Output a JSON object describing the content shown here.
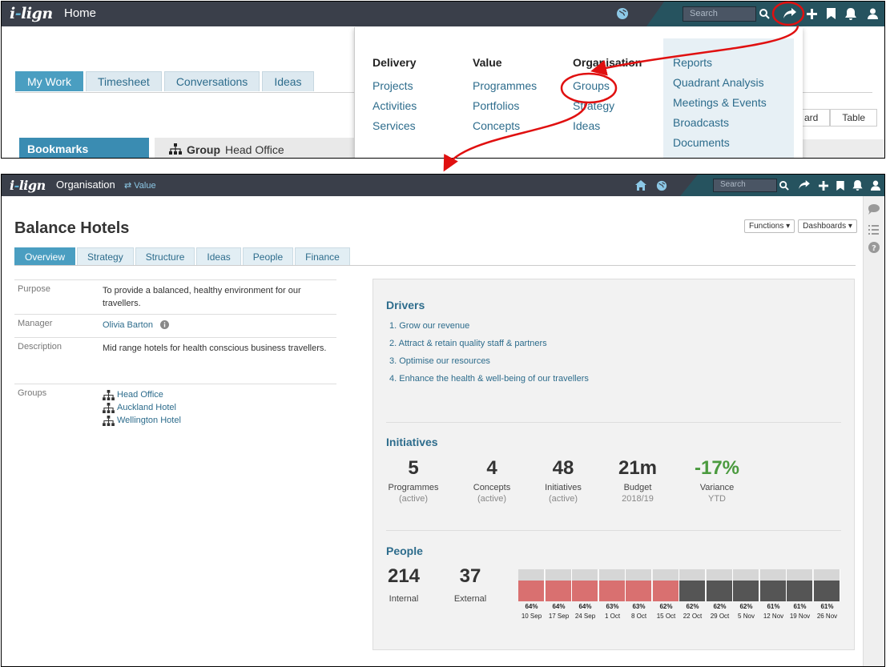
{
  "top": {
    "logo": {
      "a": "i",
      "b": "-",
      "c": "lign"
    },
    "page_title": "Home",
    "search_placeholder": "Search",
    "tabs": [
      "My Work",
      "Timesheet",
      "Conversations",
      "Ideas"
    ],
    "bookmarks": "Bookmarks",
    "group_head": {
      "bold": "Group",
      "name": "Head Office"
    },
    "view_buttons": [
      "ard",
      "Table"
    ],
    "menu": {
      "columns": [
        {
          "title": "Delivery",
          "items": [
            "Projects",
            "Activities",
            "Services"
          ]
        },
        {
          "title": "Value",
          "items": [
            "Programmes",
            "Portfolios",
            "Concepts"
          ]
        },
        {
          "title": "Organisation",
          "items": [
            "Groups",
            "Strategy",
            "Ideas"
          ]
        }
      ],
      "side": [
        "Reports",
        "Quadrant Analysis",
        "Meetings & Events",
        "Broadcasts",
        "Documents"
      ]
    }
  },
  "bottom": {
    "page_title": "Organisation",
    "crumb": "⇄ Value",
    "search_placeholder": "Search",
    "title": "Balance Hotels",
    "functions": "Functions ▾",
    "dashboards": "Dashboards ▾",
    "tabs": [
      "Overview",
      "Strategy",
      "Structure",
      "Ideas",
      "People",
      "Finance"
    ],
    "properties": {
      "purpose_k": "Purpose",
      "purpose_v": "To provide a balanced, healthy environment for our travellers.",
      "manager_k": "Manager",
      "manager_v": "Olivia Barton",
      "description_k": "Description",
      "description_v": "Mid range hotels for health conscious business travellers.",
      "groups_k": "Groups",
      "groups": [
        "Head Office",
        "Auckland Hotel",
        "Wellington Hotel"
      ]
    },
    "drivers_title": "Drivers",
    "drivers": [
      "1. Grow our revenue",
      "2. Attract & retain quality staff & partners",
      "3. Optimise our resources",
      "4. Enhance the health & well-being of our travellers"
    ],
    "initiatives_title": "Initiatives",
    "initiatives": [
      {
        "n": "5",
        "l": "Programmes",
        "s": "(active)"
      },
      {
        "n": "4",
        "l": "Concepts",
        "s": "(active)"
      },
      {
        "n": "48",
        "l": "Initiatives",
        "s": "(active)"
      },
      {
        "n": "21m",
        "l": "Budget",
        "s": "2018/19"
      },
      {
        "n": "-17%",
        "l": "Variance",
        "s": "YTD"
      }
    ],
    "people_title": "People",
    "people": [
      {
        "n": "214",
        "l": "Internal"
      },
      {
        "n": "37",
        "l": "External"
      }
    ],
    "colors": {
      "above": "#d97070",
      "below": "#555555",
      "empty": "#d6d6d6"
    }
  },
  "chart_data": {
    "type": "bar",
    "categories": [
      "10 Sep",
      "17 Sep",
      "24 Sep",
      "1 Oct",
      "8 Oct",
      "15 Oct",
      "22 Oct",
      "29 Oct",
      "5 Nov",
      "12 Nov",
      "19 Nov",
      "26 Nov"
    ],
    "values": [
      64,
      64,
      64,
      63,
      63,
      62,
      62,
      62,
      62,
      61,
      61,
      61
    ],
    "labels": [
      "64%",
      "64%",
      "64%",
      "63%",
      "63%",
      "62%",
      "62%",
      "62%",
      "62%",
      "61%",
      "61%",
      "61%"
    ],
    "highlight": [
      true,
      true,
      true,
      true,
      true,
      true,
      false,
      false,
      false,
      false,
      false,
      false
    ],
    "ylim": [
      0,
      100
    ]
  }
}
